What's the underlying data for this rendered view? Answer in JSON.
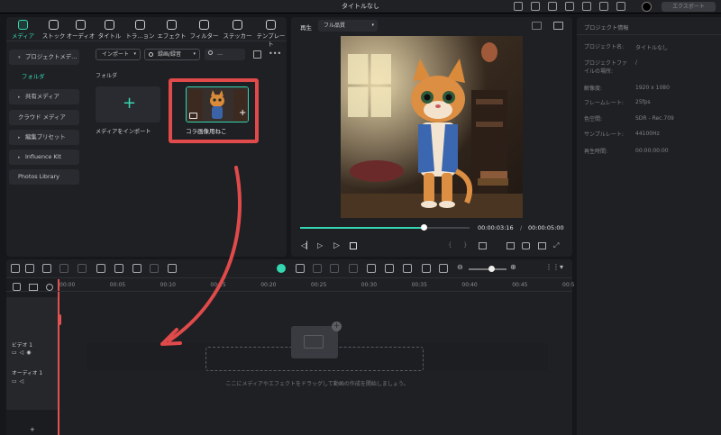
{
  "titlebar": {
    "title": "タイトルなし",
    "export_label": "エクスポート"
  },
  "toolbar": {
    "tabs": [
      {
        "label": "メディア",
        "icon": "media-icon"
      },
      {
        "label": "ストック",
        "icon": "stock-icon"
      },
      {
        "label": "オーディオ",
        "icon": "music-note-icon"
      },
      {
        "label": "タイトル",
        "icon": "text-t-icon"
      },
      {
        "label": "トラ…ョン",
        "icon": "transition-icon"
      },
      {
        "label": "エフェクト",
        "icon": "effect-icon"
      },
      {
        "label": "フィルター",
        "icon": "filter-icon"
      },
      {
        "label": "ステッカー",
        "icon": "sticker-icon"
      },
      {
        "label": "テンプレート",
        "icon": "template-icon"
      }
    ]
  },
  "sidebar": {
    "items": [
      {
        "label": "プロジェクトメデ…",
        "chev": "▾"
      },
      {
        "label": "フォルダ",
        "chev": ""
      },
      {
        "label": "共有メディア",
        "chev": "▸"
      },
      {
        "label": "クラウド メディア",
        "chev": ""
      },
      {
        "label": "編集プリセット",
        "chev": "▸"
      },
      {
        "label": "Influence Kit",
        "chev": "▸"
      },
      {
        "label": "Photos Library",
        "chev": ""
      }
    ]
  },
  "media": {
    "import_dropdown": "インポート",
    "record_dropdown": "録画/録音",
    "search_placeholder": "…",
    "folder_label": "フォルダ",
    "import_tile_label": "メディアをインポート",
    "clip_label": "コラ画像用ねこ",
    "plus_sign": "+"
  },
  "player": {
    "label": "再生",
    "quality": "フル品質",
    "current_time": "00:00:03:16",
    "separator": "/",
    "total_time": "00:00:05:00",
    "progress": 0.73
  },
  "properties": {
    "header": "プロジェクト情報",
    "rows": [
      {
        "label": "プロジェクト名:",
        "value": "タイトルなし"
      },
      {
        "label": "プロジェクトファイルの場所:",
        "value": "/"
      },
      {
        "label": "解像度:",
        "value": "1920 x 1080"
      },
      {
        "label": "フレームレート:",
        "value": "25fps"
      },
      {
        "label": "色空間:",
        "value": "SDR - Rec.709"
      },
      {
        "label": "サンプルレート:",
        "value": "44100Hz"
      },
      {
        "label": "再生時間:",
        "value": "00:00:00:00"
      }
    ]
  },
  "timeline": {
    "ticks": [
      "00:00",
      "00:05",
      "00:10",
      "00:15",
      "00:20",
      "00:25",
      "00:30",
      "00:35",
      "00:40",
      "00:45",
      "00:5"
    ],
    "tracks": [
      {
        "label": "ビデオ 1"
      },
      {
        "label": "オーディオ 1"
      }
    ],
    "drop_hint": "ここにメディアやエフェクトをドラッグして動画の作成を開始しましょう。",
    "add_track": "+",
    "zoom": 0.6
  },
  "annotation": {
    "color": "#e04a4a"
  },
  "colors": {
    "accent": "#35d6b2"
  }
}
